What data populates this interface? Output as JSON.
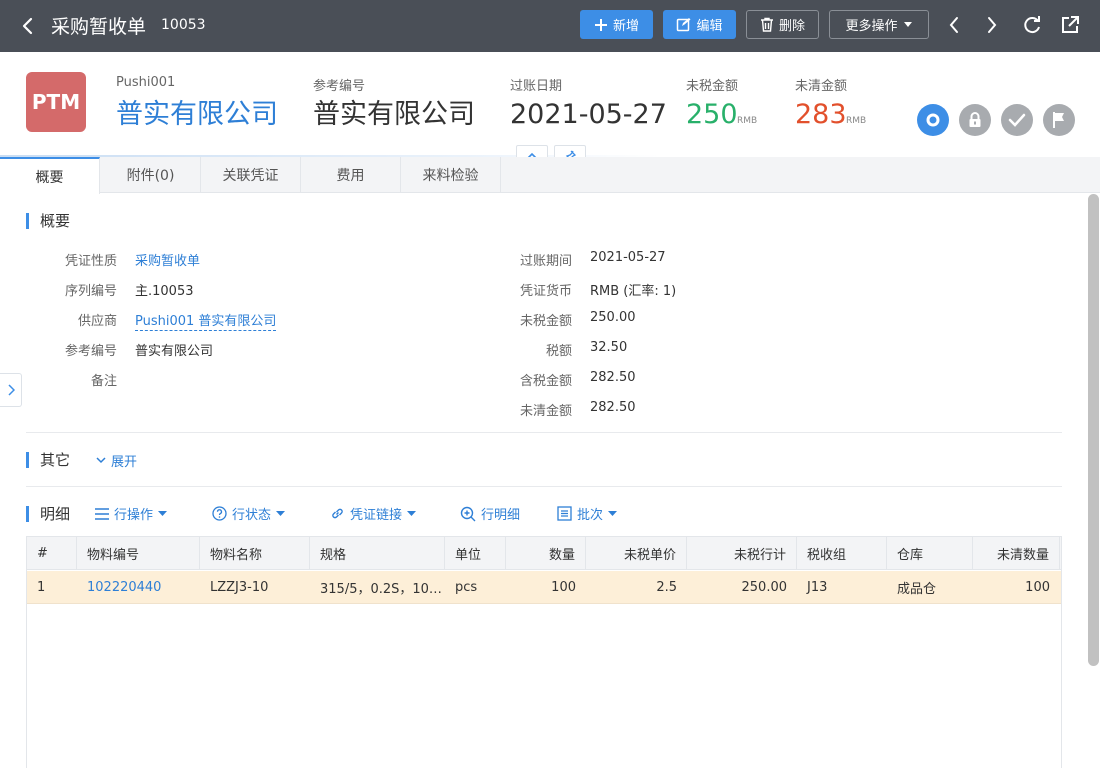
{
  "topbar": {
    "title": "采购暂收单",
    "doc_number": "10053",
    "buttons": {
      "new": "新增",
      "edit": "编辑",
      "delete": "删除",
      "more": "更多操作"
    }
  },
  "header": {
    "avatar_text": "PTM",
    "supplier_code": "Pushi001",
    "supplier_name": "普实有限公司",
    "ref_label": "参考编号",
    "ref_value": "普实有限公司",
    "date_label": "过账日期",
    "date_value": "2021-05-27",
    "untaxed_label": "未税金额",
    "untaxed_value": "250",
    "untaxed_unit": "RMB",
    "open_label": "未清金额",
    "open_value": "283",
    "open_unit": "RMB",
    "colors": {
      "accent": "#3d8ee6",
      "green": "#28b06a",
      "red": "#e2502c",
      "avatar": "#d46a6a"
    }
  },
  "tabs": [
    "概要",
    "附件(0)",
    "关联凭证",
    "费用",
    "来料检验"
  ],
  "summary": {
    "title": "概要",
    "left": [
      {
        "label": "凭证性质",
        "value": "采购暂收单"
      },
      {
        "label": "序列编号",
        "value": "主.10053"
      },
      {
        "label": "供应商",
        "value": "Pushi001 普实有限公司"
      },
      {
        "label": "参考编号",
        "value": "普实有限公司"
      },
      {
        "label": "备注",
        "value": ""
      }
    ],
    "right": [
      {
        "label": "过账期间",
        "value": "2021-05-27"
      },
      {
        "label": "凭证货币",
        "value": "RMB (汇率: 1)"
      },
      {
        "label": "未税金额",
        "value": "250.00"
      },
      {
        "label": "税额",
        "value": "32.50"
      },
      {
        "label": "含税金额",
        "value": "282.50"
      },
      {
        "label": "未清金额",
        "value": "282.50"
      }
    ]
  },
  "other": {
    "title": "其它",
    "expand": "展开"
  },
  "detail": {
    "title": "明细",
    "actions": [
      "行操作",
      "行状态",
      "凭证链接",
      "行明细",
      "批次"
    ],
    "columns": [
      "#",
      "物料编号",
      "物料名称",
      "规格",
      "单位",
      "数量",
      "未税单价",
      "未税行计",
      "税收组",
      "仓库",
      "未清数量"
    ],
    "rows": [
      [
        "1",
        "102220440",
        "LZZJ3-10",
        "315/5，0.2S，10…",
        "pcs",
        "100",
        "2.5",
        "250.00",
        "J13",
        "成品仓",
        "100"
      ]
    ]
  }
}
